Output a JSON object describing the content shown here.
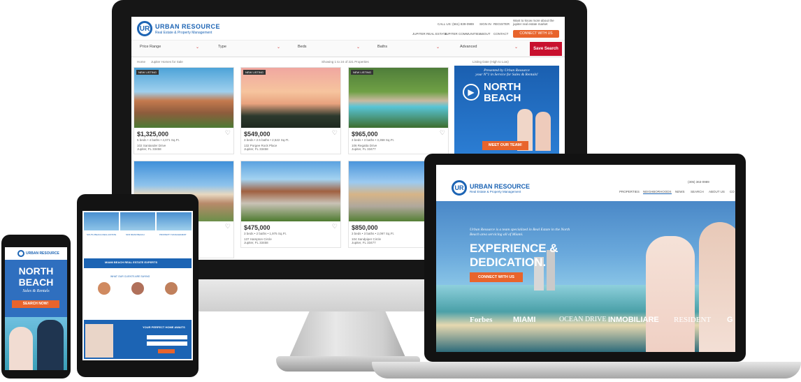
{
  "monitor": {
    "brand": {
      "name": "URBAN RESOURCE",
      "tagline": "Real Estate & Property Management"
    },
    "topbar": {
      "phone": "CALL US: (561) 839-0989",
      "signin": "SIGN IN",
      "register": "REGISTER",
      "promo": "Want to know more about the jupiter real estate market",
      "cta": "CONNECT WITH US"
    },
    "nav": [
      "JUPITER REAL ESTATE",
      "JUPITER COMMUNITIES",
      "ABOUT",
      "CONTACT"
    ],
    "filters": {
      "price": "Price Range",
      "type": "Type",
      "beds": "Beds",
      "baths": "Baths",
      "advanced": "Advanced",
      "save": "Save Search"
    },
    "breadcrumb": {
      "home": "Home",
      "current": "Jupiter Homes for Sale"
    },
    "results_count": "Showing 1 to 24 of 221 Properties",
    "sort": "Listing Date (High to Low)",
    "listings": [
      {
        "badge": "NEW LISTING",
        "price": "$1,325,000",
        "details": "5 beds  •  4 baths  •  4,071 Sq.Ft.",
        "street": "102 Santander Drive",
        "city": "Jupiter, FL 33458"
      },
      {
        "badge": "NEW LISTING",
        "price": "$549,000",
        "details": "3 beds  •  2.5 baths  •  2,522 Sq.Ft.",
        "street": "132 Porgee Rock Place",
        "city": "Jupiter, FL 33458"
      },
      {
        "badge": "NEW LISTING",
        "price": "$965,000",
        "details": "3 beds  •  3 baths  •  3,358 Sq.Ft.",
        "street": "106 Regatta Drive",
        "city": "Jupiter, FL 33477"
      },
      {
        "badge": "",
        "price": "",
        "details": "",
        "street": "",
        "city": ""
      },
      {
        "badge": "",
        "price": "$475,000",
        "details": "3 beds  •  2 baths  •  1,975 Sq.Ft.",
        "street": "137 Hampton Circle",
        "city": "Jupiter, FL 33458"
      },
      {
        "badge": "",
        "price": "$850,000",
        "details": "3 beds  •  3 baths  •  2,097 Sq.Ft.",
        "street": "104 Sandpiper Circle",
        "city": "Jupiter, FL 33477"
      }
    ],
    "ad": {
      "line1": "Presented by Urban Resource",
      "line2": "your N°1 in Service for Sales & Rentals!",
      "title1": "NORTH",
      "title2": "BEACH",
      "cta": "MEET OUR TEAM!"
    }
  },
  "laptop": {
    "brand": {
      "name": "URBAN RESOURCE",
      "tagline": "Real Estate & Property Management"
    },
    "phone": "(305) 363-0989",
    "nav": [
      "PROPERTIES",
      "NEIGHBORHOODS",
      "NEWS",
      "SEARCH",
      "ABOUT US",
      "CO"
    ],
    "intro": "Urban Resource is a team specialized in Real Estate in the North Beach area servicing all of Miami.",
    "headline1": "EXPERIENCE &",
    "headline2": "DEDICATION.",
    "cta": "CONNECT WITH US",
    "press": [
      "Forbes",
      "MIAMI",
      "OCEAN DRIVE",
      "INMOBILIARE",
      "RESIDENT",
      "G"
    ]
  },
  "tablet": {
    "labels": [
      "SOUTH BEACH REAL ESTATE",
      "SFR MIAMI BEACH",
      "PROPERTY MANAGEMENT"
    ],
    "banner": "MIAMI BEACH REAL ESTATE EXPERTS",
    "testimonials_title": "WHAT OUR CLIENTS ARE SAYING",
    "bottom_title": "YOUR PERFECT HOME AWAITS"
  },
  "phone": {
    "brand": "URBAN RESOURCE",
    "title1": "NORTH",
    "title2": "BEACH",
    "subtitle": "Sales & Rentals",
    "cta": "SEARCH NOW!"
  },
  "colors": {
    "brand_blue": "#1c64b4",
    "accent_orange": "#e8642c",
    "save_red": "#c8102e"
  }
}
